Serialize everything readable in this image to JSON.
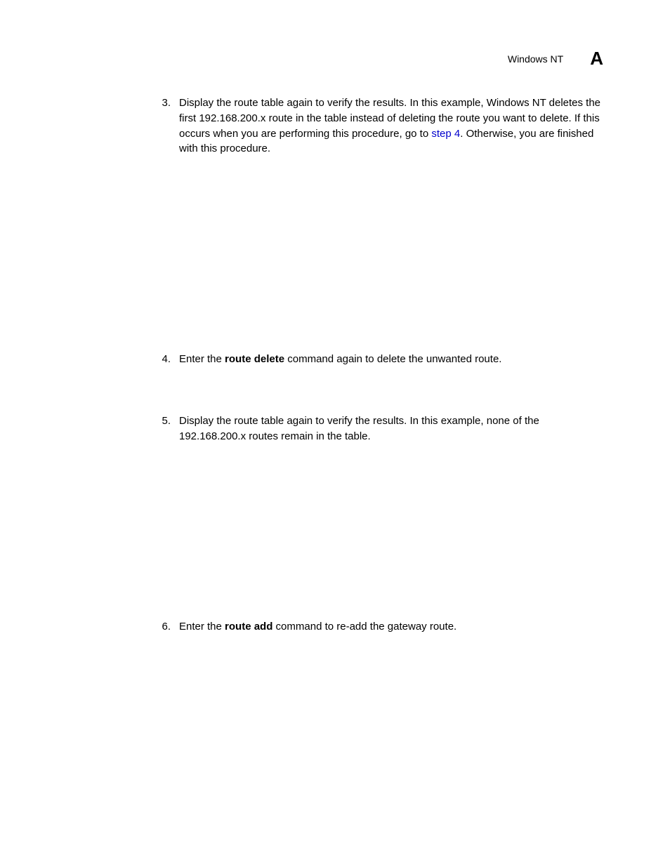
{
  "header": {
    "title": "Windows NT",
    "letter": "A"
  },
  "items": {
    "3": {
      "number": "3.",
      "text_before_link": "Display the route table again to verify the results. In this example, Windows NT deletes the first 192.168.200.x route in the table instead of deleting the route you want to delete. If this occurs when you are performing this procedure, go to ",
      "link_text": "step 4",
      "text_after_link": ". Otherwise, you are finished with this procedure."
    },
    "4": {
      "number": "4.",
      "text_before_bold": "Enter the ",
      "bold_text": "route delete",
      "text_after_bold": " command again to delete the unwanted route."
    },
    "5": {
      "number": "5.",
      "text": "Display the route table again to verify the results. In this example, none of the 192.168.200.x routes remain in the table."
    },
    "6": {
      "number": "6.",
      "text_before_bold": "Enter the ",
      "bold_text": "route add",
      "text_after_bold": " command to re-add the gateway route."
    }
  }
}
